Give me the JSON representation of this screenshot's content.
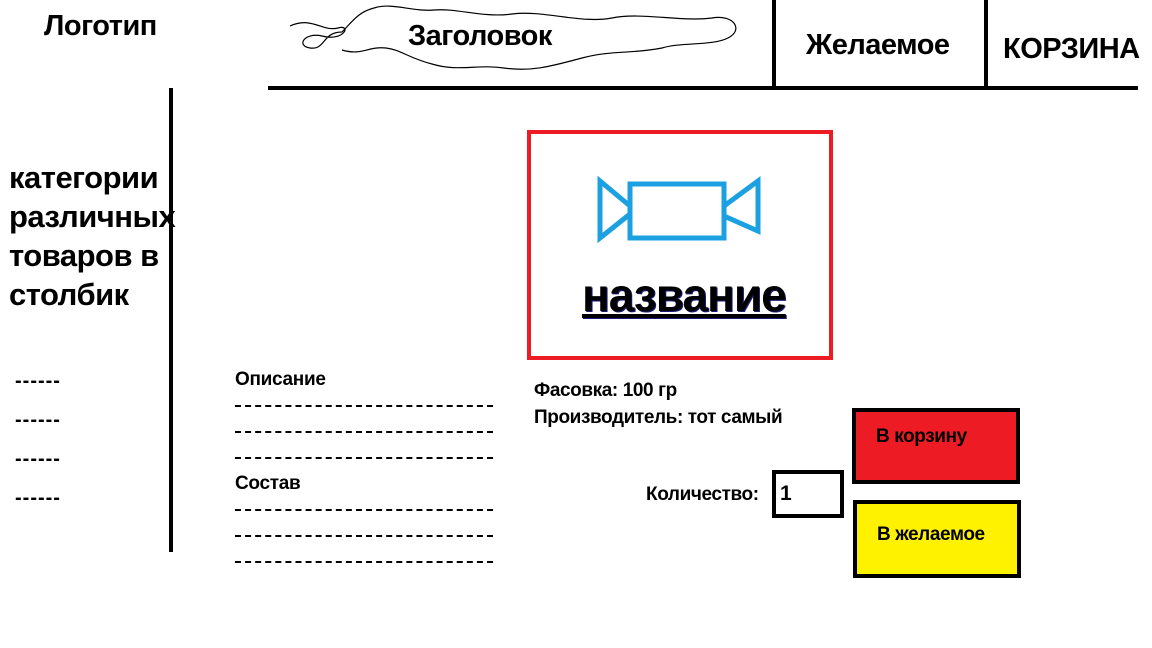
{
  "header": {
    "logo": "Логотип",
    "title": "Заголовок",
    "nav_wishlist": "Желаемое",
    "nav_cart": "КОРЗИНА"
  },
  "sidebar": {
    "categories_text": "категории различных товаров в столбик",
    "items": [
      "------",
      "------",
      "------",
      "------"
    ]
  },
  "product": {
    "icon": "candy-icon",
    "name": "название",
    "packaging": "Фасовка: 100 гр",
    "manufacturer": "Производитель: тот самый"
  },
  "details": {
    "description_title": "Описание",
    "composition_title": "Состав"
  },
  "purchase": {
    "quantity_label": "Количество:",
    "quantity_value": "1",
    "add_to_cart": "В корзину",
    "add_to_wishlist": "В желаемое"
  },
  "colors": {
    "product_border": "#ed1c24",
    "cart_button": "#ed1c24",
    "wishlist_button": "#fff200",
    "candy_icon": "#1ba1e2"
  }
}
